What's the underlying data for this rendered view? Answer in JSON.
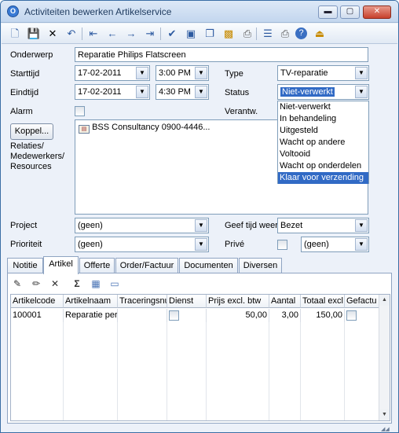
{
  "window": {
    "title": "Activiteiten bewerken Artikelservice",
    "controls": {
      "minimize": "▬",
      "maximize": "▢",
      "close": "✕"
    }
  },
  "toolbar_icons": [
    "new-document-icon",
    "save-icon",
    "delete-icon",
    "undo-icon",
    "first-record-icon",
    "previous-record-icon",
    "next-record-icon",
    "last-record-icon",
    "checkmark-icon",
    "preview-icon",
    "copy-icon",
    "attachment-icon",
    "print-icon",
    "properties-icon",
    "print-setup-icon",
    "help-icon",
    "exit-icon"
  ],
  "form": {
    "onderwerp": {
      "label": "Onderwerp",
      "value": "Reparatie Philips Flatscreen"
    },
    "starttijd": {
      "label": "Starttijd",
      "date": "17-02-2011",
      "time": "3:00 PM"
    },
    "eindtijd": {
      "label": "Eindtijd",
      "date": "17-02-2011",
      "time": "4:30 PM"
    },
    "type": {
      "label": "Type",
      "value": "TV-reparatie"
    },
    "status": {
      "label": "Status",
      "value": "Niet-verwerkt",
      "options": [
        "Niet-verwerkt",
        "In behandeling",
        "Uitgesteld",
        "Wacht op andere",
        "Voltooid",
        "Wacht op onderdelen",
        "Klaar voor verzending"
      ],
      "highlighted": "Klaar voor verzending"
    },
    "alarm": {
      "label": "Alarm"
    },
    "verantw": {
      "label": "Verantw."
    },
    "koppel_button": "Koppel...",
    "relaties_label": [
      "Relaties/",
      "Medewerkers/",
      "Resources"
    ],
    "relaties_item": "BSS Consultancy 0900-4446...",
    "project": {
      "label": "Project",
      "value": "(geen)"
    },
    "prioriteit": {
      "label": "Prioriteit",
      "value": "(geen)"
    },
    "geef_tijd_weer": {
      "label": "Geef tijd weer",
      "value": "Bezet"
    },
    "prive": {
      "label": "Privé",
      "value": "(geen)"
    }
  },
  "tabs": [
    "Notitie",
    "Artikel",
    "Offerte",
    "Order/Factuur",
    "Documenten",
    "Diversen"
  ],
  "active_tab": "Artikel",
  "grid": {
    "columns": [
      "Artikelcode",
      "Artikelnaam",
      "Traceringsnu",
      "Dienst",
      "Prijs excl. btw",
      "Aantal",
      "Totaal excl.",
      "Gefactu"
    ],
    "rows": [
      {
        "artikelcode": "100001",
        "artikelnaam": "Reparatie per",
        "traceringsnummer": "",
        "dienst": false,
        "prijs": "50,00",
        "aantal": "3,00",
        "totaal": "150,00",
        "gefactureerd": false
      }
    ]
  },
  "colors": {
    "accent": "#316ac5",
    "window_border": "#3a6ea5",
    "background": "#ecf1f9"
  }
}
